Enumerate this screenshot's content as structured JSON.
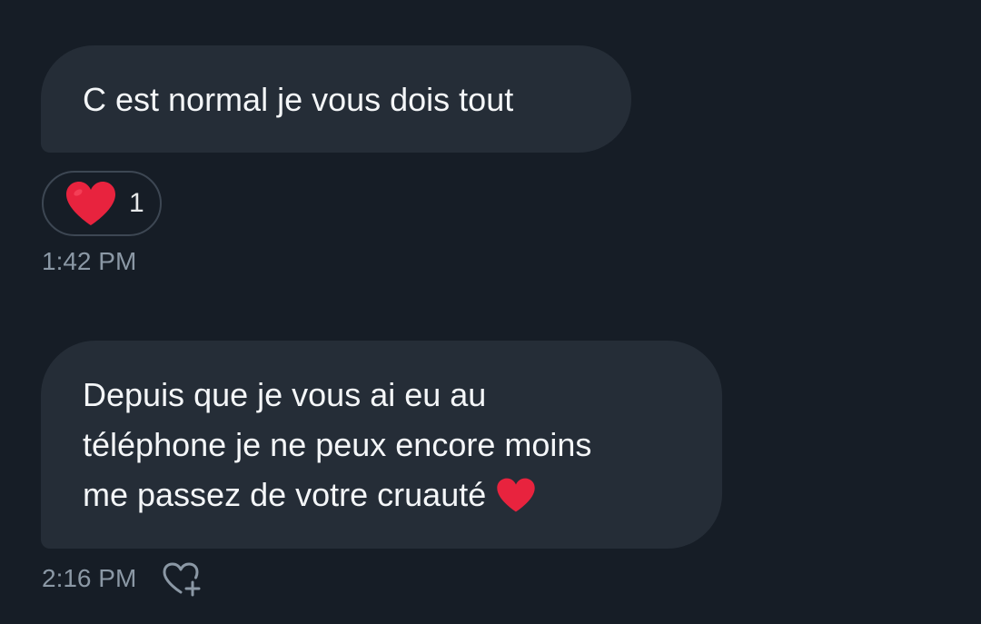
{
  "messages": [
    {
      "text_lines": [
        "C est normal je vous dois tout"
      ],
      "reaction": {
        "icon": "heart-icon",
        "count": "1",
        "color": "#e8233e"
      },
      "time": "1:42 PM"
    },
    {
      "text_lines": [
        "Depuis que je vous ai eu au",
        "téléphone je ne peux encore moins",
        "me passez de votre cruauté"
      ],
      "trailing_emoji": "red-heart-emoji",
      "time": "2:16 PM",
      "add_reaction_icon": "heart-plus-icon"
    }
  ],
  "colors": {
    "background": "#161d26",
    "bubble": "#252d37",
    "text": "#f4f6f8",
    "muted": "#8b98a5",
    "heart": "#e8233e"
  }
}
